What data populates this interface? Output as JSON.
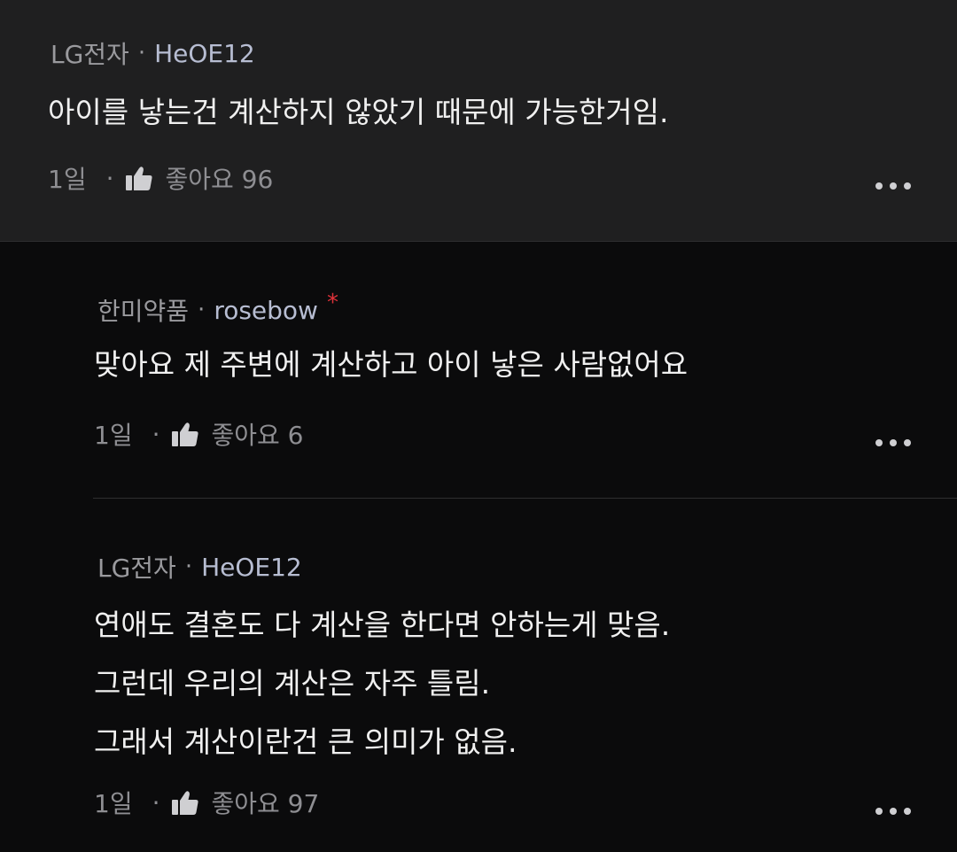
{
  "comments": [
    {
      "company": "LG전자",
      "nickname": "HeOE12",
      "body": [
        "아이를 낳는건 계산하지 않았기 때문에 가능한거임."
      ],
      "time": "1일",
      "likes_label": "좋아요 96"
    },
    {
      "company": "한미약품",
      "nickname": "rosebow",
      "author_marker": "*",
      "body": [
        "맞아요 제 주변에 계산하고 아이 낳은 사람없어요"
      ],
      "time": "1일",
      "likes_label": "좋아요 6"
    },
    {
      "company": "LG전자",
      "nickname": "HeOE12",
      "body": [
        "연애도 결혼도 다 계산을 한다면 안하는게 맞음.",
        "그런데 우리의 계산은 자주 틀림.",
        "그래서 계산이란건 큰 의미가 없음."
      ],
      "time": "1일",
      "likes_label": "좋아요 97"
    }
  ],
  "separator": "·",
  "icons": {
    "like": "thumbs-up-icon",
    "more": "more-horizontal-icon"
  },
  "colors": {
    "background": "#0b0b0c",
    "top_comment_bg": "#1f1f20",
    "nickname": "#b7bdd2",
    "marker": "#e0323a"
  }
}
